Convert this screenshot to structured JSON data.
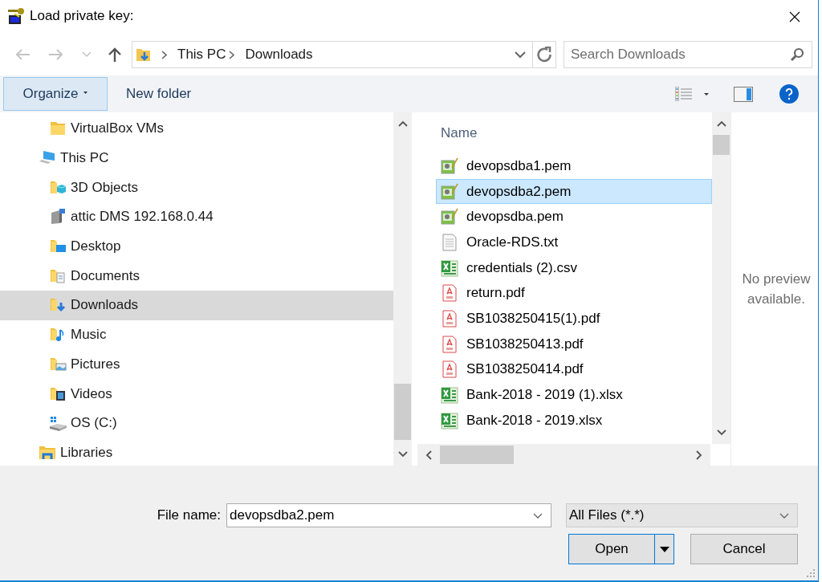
{
  "window": {
    "title": "Load private key:"
  },
  "navigation": {
    "path": [
      "This PC",
      "Downloads"
    ],
    "search": {
      "placeholder": "Search Downloads"
    }
  },
  "toolbar": {
    "buttons": [
      {
        "label": "Organize",
        "kind": "menu",
        "highlighted": true
      },
      {
        "label": "New folder",
        "kind": "plain",
        "highlighted": false
      }
    ]
  },
  "nav_pane": {
    "continued_children": [
      {
        "label": "VirtualBox VMs",
        "kind": "folder",
        "selected": false
      }
    ],
    "items": [
      {
        "label": "This PC",
        "kind": "pc",
        "selected": false,
        "children": [
          {
            "label": "3D Objects",
            "kind": "objects3d",
            "selected": false
          },
          {
            "label": "attic DMS 192.168.0.44",
            "kind": "nas",
            "selected": false
          },
          {
            "label": "Desktop",
            "kind": "desktop",
            "selected": false
          },
          {
            "label": "Documents",
            "kind": "documents",
            "selected": false
          },
          {
            "label": "Downloads",
            "kind": "downloads",
            "selected": true
          },
          {
            "label": "Music",
            "kind": "music",
            "selected": false
          },
          {
            "label": "Pictures",
            "kind": "pictures",
            "selected": false
          },
          {
            "label": "Videos",
            "kind": "videos",
            "selected": false
          },
          {
            "label": "OS (C:)",
            "kind": "drive",
            "selected": false
          }
        ]
      },
      {
        "label": "Libraries",
        "kind": "libraries",
        "selected": false
      }
    ]
  },
  "file_list": {
    "columns": [
      "Name"
    ],
    "files": [
      {
        "name": "devopsdba1.pem",
        "kind": "key",
        "selected": false
      },
      {
        "name": "devopsdba2.pem",
        "kind": "key",
        "selected": true
      },
      {
        "name": "devopsdba.pem",
        "kind": "key",
        "selected": false
      },
      {
        "name": "Oracle-RDS.txt",
        "kind": "text",
        "selected": false
      },
      {
        "name": "credentials (2).csv",
        "kind": "sheet",
        "selected": false
      },
      {
        "name": "return.pdf",
        "kind": "pdf",
        "selected": false
      },
      {
        "name": "SB1038250415(1).pdf",
        "kind": "pdf",
        "selected": false
      },
      {
        "name": "SB1038250413.pdf",
        "kind": "pdf",
        "selected": false
      },
      {
        "name": "SB1038250414.pdf",
        "kind": "pdf",
        "selected": false
      },
      {
        "name": "Bank-2018 - 2019 (1).xlsx",
        "kind": "sheet",
        "selected": false
      },
      {
        "name": "Bank-2018 - 2019.xlsx",
        "kind": "sheet",
        "selected": false
      }
    ]
  },
  "preview": {
    "message": "No preview available."
  },
  "footer": {
    "file_name_label": "File name:",
    "file_name": "devopsdba2.pem",
    "file_type": "All Files (*.*)",
    "buttons": [
      {
        "label": "Open",
        "kind": "split"
      },
      {
        "label": "Cancel",
        "kind": "plain"
      }
    ]
  }
}
